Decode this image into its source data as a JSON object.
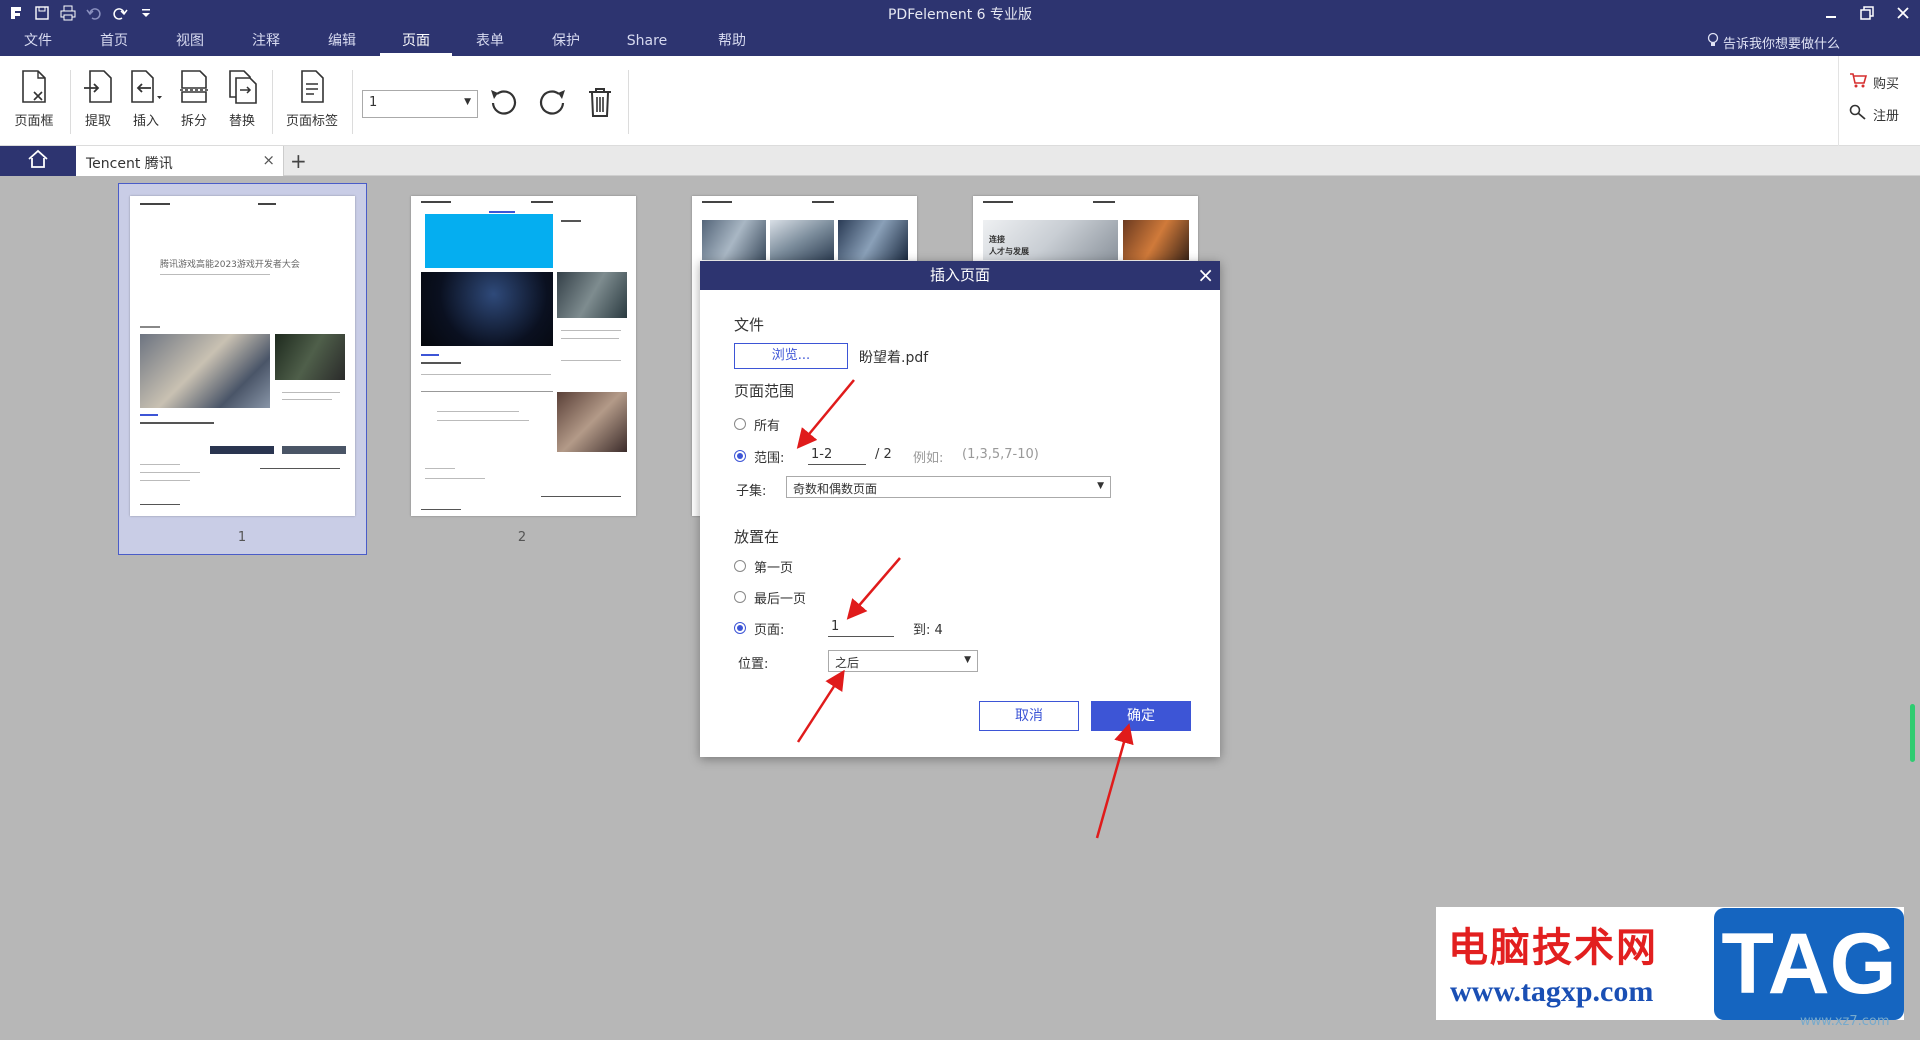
{
  "app": {
    "title": "PDFelement 6 专业版"
  },
  "menu": [
    {
      "label": "文件"
    },
    {
      "label": "首页"
    },
    {
      "label": "视图"
    },
    {
      "label": "注释"
    },
    {
      "label": "编辑"
    },
    {
      "label": "页面"
    },
    {
      "label": "表单"
    },
    {
      "label": "保护"
    },
    {
      "label": "Share"
    },
    {
      "label": "帮助"
    }
  ],
  "tell_me": "告诉我你想要做什么",
  "ribbon": {
    "page_box": "页面框",
    "extract": "提取",
    "insert": "插入",
    "split": "拆分",
    "replace": "替换",
    "page_label": "页面标签",
    "page_select_value": "1",
    "buy": "购买",
    "register": "注册"
  },
  "tabs": {
    "doc_tab": "Tencent 腾讯"
  },
  "thumbnails": {
    "page1_num": "1",
    "page2_num": "2",
    "page1_title": "腾讯游戏高能2023游戏开发者大会",
    "page4_text1": "连接",
    "page4_text2": "人才与发展"
  },
  "dialog": {
    "title": "插入页面",
    "file_label": "文件",
    "browse_button": "浏览...",
    "file_name": "盼望着.pdf",
    "page_range_label": "页面范围",
    "all_option": "所有",
    "range_option": "范围:",
    "range_value": "1-2",
    "range_total": "/ 2",
    "example_label": "例如:",
    "example_value": "(1,3,5,7-10)",
    "subset_label": "子集:",
    "subset_value": "奇数和偶数页面",
    "place_label": "放置在",
    "first_page_option": "第一页",
    "last_page_option": "最后一页",
    "page_option": "页面:",
    "page_value": "1",
    "to_label": "到: 4",
    "position_label": "位置:",
    "position_value": "之后",
    "cancel_button": "取消",
    "ok_button": "确定"
  },
  "watermark": {
    "title": "电脑技术网",
    "url": "www.tagxp.com",
    "tag": "TAG",
    "small": "www.xz7.com"
  },
  "colors": {
    "titlebar": "#2d3470",
    "accent": "#3d55d6",
    "annotation_arrow": "#e01b1b"
  }
}
